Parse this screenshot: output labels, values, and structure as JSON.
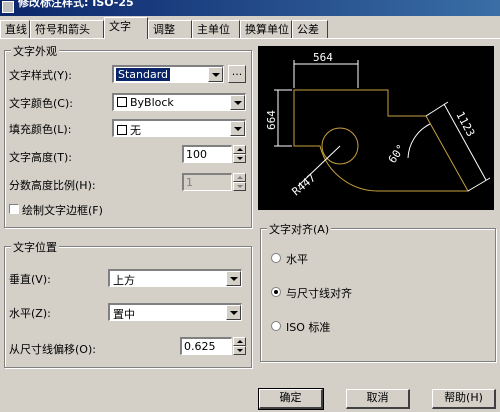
{
  "window": {
    "title": "修改标注样式: ISO-25"
  },
  "tabs": [
    "直线",
    "符号和箭头",
    "文字",
    "调整",
    "主单位",
    "换算单位",
    "公差"
  ],
  "text_appearance": {
    "group_title": "文字外观",
    "style_label": "文字样式(Y):",
    "style_value": "Standard",
    "ellipsis": "...",
    "color_label": "文字颜色(C):",
    "color_value": "ByBlock",
    "fill_label": "填充颜色(L):",
    "fill_value": "无",
    "height_label": "文字高度(T):",
    "height_value": "100",
    "fraction_label": "分数高度比例(H):",
    "fraction_value": "1",
    "frame_label": "绘制文字边框(F)"
  },
  "text_placement": {
    "group_title": "文字位置",
    "vertical_label": "垂直(V):",
    "vertical_value": "上方",
    "horizontal_label": "水平(Z):",
    "horizontal_value": "置中",
    "offset_label": "从尺寸线偏移(O):",
    "offset_value": "0.625"
  },
  "text_alignment": {
    "group_title": "文字对齐(A)",
    "options": [
      "水平",
      "与尺寸线对齐",
      "ISO 标准"
    ],
    "selected": 1
  },
  "preview": {
    "dim_top": "564",
    "dim_left": "664",
    "dim_right": "1123",
    "dim_radius": "R447",
    "dim_angle": "60°",
    "line_color": "#ffffff",
    "geometry_color": "#c8a040"
  },
  "buttons": {
    "ok": "确定",
    "cancel": "取消",
    "help": "帮助(H)"
  }
}
